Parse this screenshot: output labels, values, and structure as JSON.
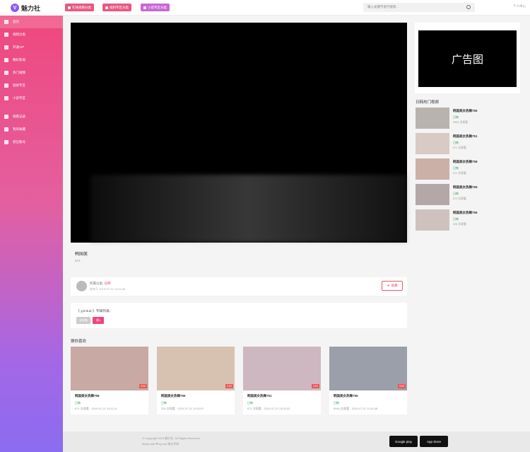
{
  "brand": {
    "logo_letter": "V",
    "name": "魅力社"
  },
  "sidebar": {
    "items": [
      {
        "label": "首页",
        "icon": "home-icon"
      },
      {
        "label": "视频分类",
        "icon": "grid-icon"
      },
      {
        "label": "开通VIP",
        "icon": "cart-icon"
      },
      {
        "label": "精彩影视",
        "icon": "user-icon"
      },
      {
        "label": "热门视频",
        "icon": "fire-icon"
      },
      {
        "label": "短视专区",
        "icon": "play-icon"
      },
      {
        "label": "小说专区",
        "icon": "book-icon"
      },
      {
        "label": "观看记录",
        "icon": "history-icon"
      },
      {
        "label": "我的收藏",
        "icon": "heart-icon"
      },
      {
        "label": "退出账号",
        "icon": "logout-icon"
      }
    ]
  },
  "topbar": {
    "tags": [
      {
        "label": "在线视频分类",
        "color": "#e85880"
      },
      {
        "label": "福利专区分类",
        "color": "#e85880"
      },
      {
        "label": "小说专区分类",
        "color": "#c866d6"
      }
    ],
    "search_placeholder": "输入关键字进行搜索...",
    "login": "个人中心"
  },
  "video": {
    "title": "韩国美",
    "meta": "672 ·"
  },
  "author": {
    "prefix": "所属分类:",
    "user": "日韩",
    "time": "发布于 2019-07-21 13:02:46",
    "fav_label": "收藏"
  },
  "album": {
    "title": "《 yjm3u8 》专辑列表：",
    "btn1": "全部集",
    "btn2": "第1"
  },
  "recommend": {
    "title": "猜你喜欢",
    "items": [
      {
        "name": "韩国美女热舞758",
        "cat": "日韩",
        "stats": "671 次观看 · 2019-07-21 13:11:11",
        "dur": "0:00"
      },
      {
        "name": "韩国美女热舞756",
        "cat": "日韩",
        "stats": "328 次观看 · 2019-07-21 13:02:57",
        "dur": "0:00"
      },
      {
        "name": "韩国美女热舞751",
        "cat": "日韩",
        "stats": "671 次观看 · 2019-07-21 13:02:02",
        "dur": "0:00"
      },
      {
        "name": "韩国美女热舞755",
        "cat": "日韩",
        "stats": "5994 次观看 · 2019-07-21 13:11:08",
        "dur": "0:00"
      }
    ]
  },
  "ad": {
    "label": "广告图"
  },
  "hot": {
    "title": "日韩热门视频",
    "items": [
      {
        "name": "韩国美女热舞755",
        "cat": "日韩",
        "views": "5994 次观看"
      },
      {
        "name": "韩国美女热舞751",
        "cat": "日韩",
        "views": "671 次观看"
      },
      {
        "name": "韩国美女热舞758",
        "cat": "日韩",
        "views": "671 次观看"
      },
      {
        "name": "韩国美女热舞759",
        "cat": "日韩",
        "views": "672 次观看"
      },
      {
        "name": "韩国美女热舞756",
        "cat": "日韩",
        "views": "328 次观看"
      }
    ]
  },
  "footer": {
    "copyright": "© Copyright 2019 魅力社. All Rights Reserved",
    "made": "Made with ❤ by  sss 统计代码",
    "google": "Google play",
    "apple": "App Store"
  }
}
